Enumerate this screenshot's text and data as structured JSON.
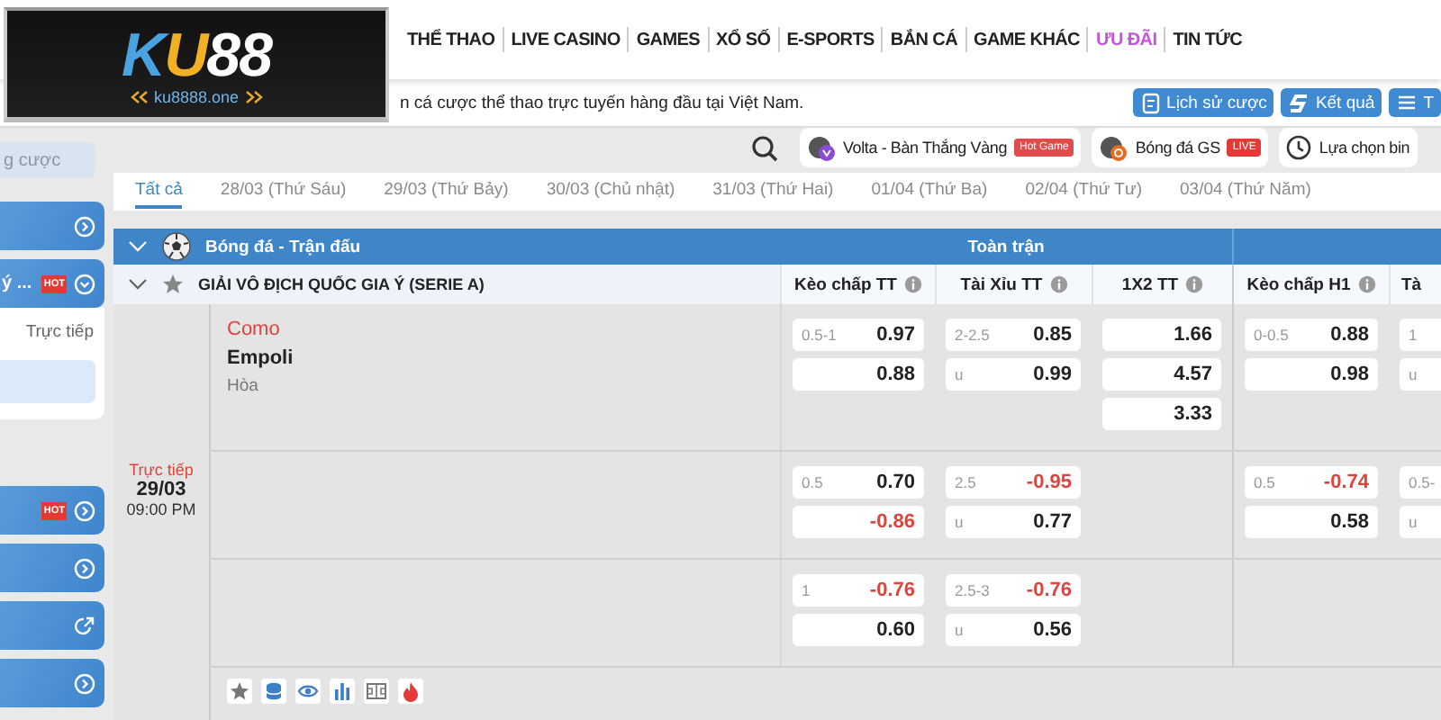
{
  "logo": {
    "brand": "KU88",
    "url": "ku8888.one"
  },
  "nav": [
    {
      "label": "THỂ THAO",
      "highlight": false
    },
    {
      "label": "LIVE CASINO",
      "highlight": false
    },
    {
      "label": "GAMES",
      "highlight": false
    },
    {
      "label": "XỔ SỐ",
      "highlight": false
    },
    {
      "label": "E-SPORTS",
      "highlight": false
    },
    {
      "label": "BẮN CÁ",
      "highlight": false
    },
    {
      "label": "GAME KHÁC",
      "highlight": false
    },
    {
      "label": "ƯU ĐÃI",
      "highlight": true
    },
    {
      "label": "TIN TỨC",
      "highlight": false
    }
  ],
  "ticker": "n cá cược thể thao trực tuyến hàng đầu tại Việt Nam.",
  "top_buttons": [
    {
      "kind": "history",
      "label": "Lịch sử cược"
    },
    {
      "kind": "results",
      "label": "Kết quả"
    },
    {
      "kind": "menu",
      "label": "T"
    }
  ],
  "sidebar": {
    "search_placeholder": "g cược",
    "items": [
      {
        "kind": "arrow"
      },
      {
        "kind": "expand",
        "label": "ý ...",
        "badge": "HOT"
      },
      {
        "kind": "panel",
        "label": "Trực tiếp"
      },
      {
        "kind": "arrow",
        "badge": "HOT"
      },
      {
        "kind": "arrow"
      },
      {
        "kind": "link"
      },
      {
        "kind": "arrow"
      }
    ]
  },
  "filters": {
    "chips": [
      {
        "kind": "game",
        "label": "Volta - Bàn Thắng Vàng",
        "badge": "Hot Game"
      },
      {
        "kind": "game",
        "label": "Bóng đá GS",
        "badge": "LIVE"
      },
      {
        "kind": "picker",
        "label": "Lựa chọn bin"
      }
    ]
  },
  "date_tabs": [
    {
      "label": "Tất cả",
      "selected": true
    },
    {
      "label": "28/03 (Thứ Sáu)",
      "selected": false
    },
    {
      "label": "29/03 (Thứ Bảy)",
      "selected": false
    },
    {
      "label": "30/03 (Chủ nhật)",
      "selected": false
    },
    {
      "label": "31/03 (Thứ Hai)",
      "selected": false
    },
    {
      "label": "01/04 (Thứ Ba)",
      "selected": false
    },
    {
      "label": "02/04 (Thứ Tư)",
      "selected": false
    },
    {
      "label": "03/04 (Thứ Năm)",
      "selected": false
    }
  ],
  "table": {
    "sport": "Bóng đá - Trận đấu",
    "period": "Toàn trận",
    "league": "GIẢI VÔ ĐỊCH QUỐC GIA Ý (SERIE A)",
    "columns": [
      {
        "label": "Kèo chấp TT",
        "info": true
      },
      {
        "label": "Tài Xỉu TT",
        "info": true
      },
      {
        "label": "1X2 TT",
        "info": true
      },
      {
        "label": "Kèo chấp H1",
        "info": true
      },
      {
        "label": "Tà",
        "info": false
      }
    ],
    "match": {
      "status": "Trực tiếp",
      "date": "29/03",
      "time": "09:00 PM",
      "home": "Como",
      "away": "Empoli",
      "draw": "Hòa",
      "rows": [
        [
          [
            {
              "line": "0.5-1",
              "odds": "0.97",
              "negative": false
            },
            {
              "odds": "0.88",
              "negative": false
            }
          ],
          [
            {
              "line": "2-2.5",
              "odds": "0.85",
              "negative": false
            },
            {
              "line": "u",
              "odds": "0.99",
              "negative": false
            }
          ],
          [
            {
              "odds": "1.66",
              "negative": false
            },
            {
              "odds": "4.57",
              "negative": false
            },
            {
              "odds": "3.33",
              "negative": false
            }
          ],
          [
            {
              "line": "0-0.5",
              "odds": "0.88",
              "negative": false
            },
            {
              "odds": "0.98",
              "negative": false
            }
          ],
          [
            {
              "line": "1"
            },
            {
              "line": "u"
            }
          ]
        ],
        [
          [
            {
              "line": "0.5",
              "odds": "0.70",
              "negative": false
            },
            {
              "odds": "-0.86",
              "negative": true
            }
          ],
          [
            {
              "line": "2.5",
              "odds": "-0.95",
              "negative": true
            },
            {
              "line": "u",
              "odds": "0.77",
              "negative": false
            }
          ],
          [],
          [
            {
              "line": "0.5",
              "odds": "-0.74",
              "negative": true
            },
            {
              "odds": "0.58",
              "negative": false
            }
          ],
          [
            {
              "line": "0.5-"
            },
            {
              "line": "u"
            }
          ]
        ],
        [
          [
            {
              "line": "1",
              "odds": "-0.76",
              "negative": true
            },
            {
              "odds": "0.60",
              "negative": false
            }
          ],
          [
            {
              "line": "2.5-3",
              "odds": "-0.76",
              "negative": true
            },
            {
              "line": "u",
              "odds": "0.56",
              "negative": false
            }
          ],
          [],
          [],
          []
        ]
      ]
    }
  }
}
